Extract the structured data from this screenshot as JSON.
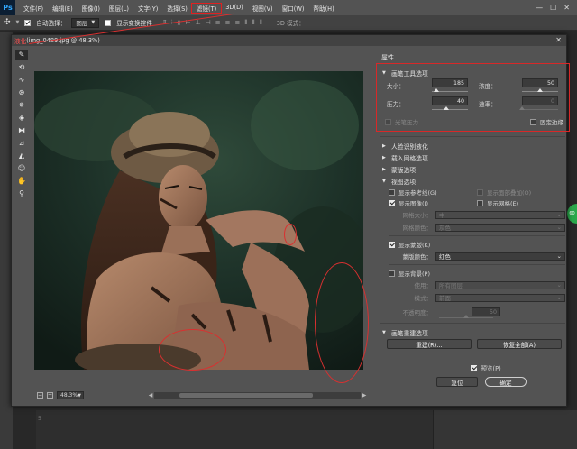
{
  "app": {
    "logo": "Ps",
    "menu": [
      "文件(F)",
      "编辑(E)",
      "图像(I)",
      "图层(L)",
      "文字(Y)",
      "选择(S)",
      "滤镜(T)",
      "3D(D)",
      "视图(V)",
      "窗口(W)",
      "帮助(H)"
    ],
    "active_menu_index": 6,
    "window_controls": [
      "—",
      "☐",
      "✕"
    ]
  },
  "options_bar": {
    "auto_select_label": "自动选择：",
    "auto_select_checked": true,
    "auto_select_target": "图层",
    "show_transform_label": "显示变换控件",
    "show_transform_checked": false,
    "mode_3d_label": "3D 模式："
  },
  "dialog": {
    "title_red": "液化",
    "title_rest": " (img_0489.jpg @ 48.3%)",
    "close": "✕",
    "zoom": "48.3%",
    "tools": [
      "forward-warp",
      "reconstruct",
      "smooth",
      "twirl",
      "pucker",
      "bloat",
      "push-left",
      "freeze-mask",
      "thaw-mask",
      "face",
      "hand",
      "zoom"
    ]
  },
  "panel": {
    "title": "属性",
    "brush": {
      "header": "画笔工具选项",
      "size_label": "大小：",
      "size_value": "185",
      "size_level": 0.12,
      "density_label": "浓度：",
      "density_value": "50",
      "density_level": 0.5,
      "pressure_label": "压力：",
      "pressure_value": "40",
      "pressure_level": 0.4,
      "rate_label": "速率：",
      "rate_value": "0",
      "rate_level": 0,
      "stylus_label": "光笔压力",
      "stylus_checked": false,
      "pin_edges_label": "固定边缘",
      "pin_edges_checked": false
    },
    "collapsed_sections": [
      "人脸识别液化",
      "载入网格选项",
      "蒙版选项"
    ],
    "view": {
      "header": "视图选项",
      "show_guides_label": "显示参考线(G)",
      "show_guides_checked": false,
      "show_face_overlay_label": "显示面部叠加(O)",
      "show_face_overlay_checked": false,
      "show_image_label": "显示图像(I)",
      "show_image_checked": true,
      "show_mesh_label": "显示网格(E)",
      "show_mesh_checked": false,
      "mesh_size_label": "网格大小：",
      "mesh_size_value": "中",
      "mesh_color_label": "网格颜色：",
      "mesh_color_value": "灰色",
      "show_mask_label": "显示蒙版(K)",
      "show_mask_checked": true,
      "mask_color_label": "蒙版颜色：",
      "mask_color_value": "红色",
      "show_backdrop_label": "显示背景(P)",
      "show_backdrop_checked": false,
      "use_label": "使用：",
      "use_value": "所有图层",
      "mode_label": "模式：",
      "mode_value": "前面",
      "opacity_label": "不透明度：",
      "opacity_value": "50",
      "opacity_level": 0.5
    },
    "reconstruct": {
      "header": "画笔重建选项",
      "reconstruct_button": "重建(R)...",
      "restore_all_button": "恢复全部(A)"
    },
    "preview_label": "预览(P)",
    "preview_checked": true,
    "reset_button": "复位",
    "ok_button": "确定"
  },
  "right_edge_badge": "60",
  "ruler_tick": "5"
}
